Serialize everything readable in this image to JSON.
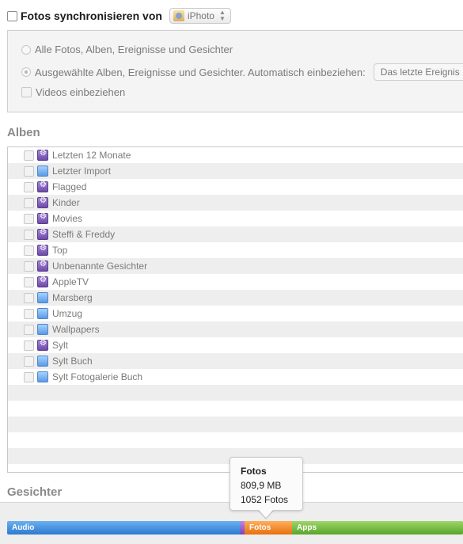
{
  "sync": {
    "label": "Fotos synchronisieren von",
    "source": "iPhoto",
    "checked": false
  },
  "options": {
    "all": "Alle Fotos, Alben, Ereignisse und Gesichter",
    "selected": "Ausgewählte Alben, Ereignisse und Gesichter. Automatisch einbeziehen:",
    "period": "Das letzte Ereignis",
    "videos": "Videos einbeziehen"
  },
  "albums_title": "Alben",
  "faces_title": "Gesichter",
  "albums": [
    {
      "label": "Letzten 12 Monate",
      "icon": "smart-album-icon"
    },
    {
      "label": "Letzter Import",
      "icon": "album-icon"
    },
    {
      "label": "Flagged",
      "icon": "smart-album-icon"
    },
    {
      "label": "Kinder",
      "icon": "smart-album-icon"
    },
    {
      "label": "Movies",
      "icon": "smart-album-icon"
    },
    {
      "label": "Steffi & Freddy",
      "icon": "smart-album-icon"
    },
    {
      "label": "Top",
      "icon": "smart-album-icon"
    },
    {
      "label": "Unbenannte Gesichter",
      "icon": "smart-album-icon"
    },
    {
      "label": "AppleTV",
      "icon": "smart-album-icon"
    },
    {
      "label": "Marsberg",
      "icon": "album-icon"
    },
    {
      "label": "Umzug",
      "icon": "album-icon"
    },
    {
      "label": "Wallpapers",
      "icon": "album-icon"
    },
    {
      "label": "Sylt",
      "icon": "smart-album-icon"
    },
    {
      "label": "Sylt Buch",
      "icon": "album-icon"
    },
    {
      "label": "Sylt Fotogalerie Buch",
      "icon": "album-icon"
    }
  ],
  "tooltip": {
    "title": "Fotos",
    "size": "809,9 MB",
    "count": "1052 Fotos"
  },
  "capacity": {
    "audio": "Audio",
    "photos": "Fotos",
    "apps": "Apps",
    "colors": {
      "audio": "#3a86d8",
      "other": "#9a5ad0",
      "photos": "#f08423",
      "apps": "#6ab43a"
    }
  }
}
